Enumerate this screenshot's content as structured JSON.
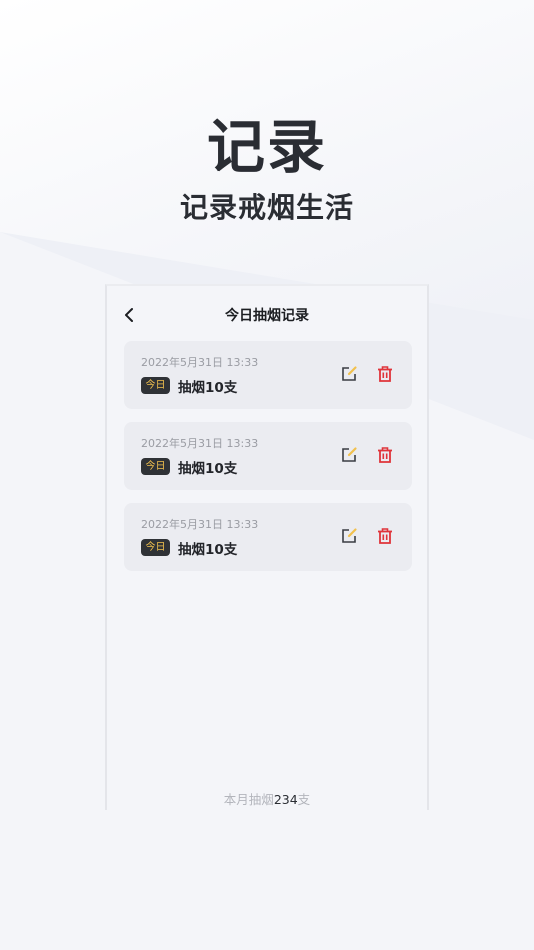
{
  "hero": {
    "title": "记录",
    "subtitle": "记录戒烟生活"
  },
  "screen": {
    "nav_title": "今日抽烟记录",
    "records": [
      {
        "time": "2022年5月31日 13:33",
        "badge": "今日",
        "text": "抽烟10支"
      },
      {
        "time": "2022年5月31日 13:33",
        "badge": "今日",
        "text": "抽烟10支"
      },
      {
        "time": "2022年5月31日 13:33",
        "badge": "今日",
        "text": "抽烟10支"
      }
    ],
    "footer": {
      "prefix": "本月抽烟",
      "count": "234",
      "suffix": "支"
    }
  },
  "icons": {
    "back": "chevron-left-icon",
    "edit": "edit-icon",
    "delete": "trash-icon"
  },
  "colors": {
    "badge_bg": "#2f3236",
    "badge_text": "#f2c14e",
    "delete": "#e0343a",
    "edit_accent": "#f2c14e"
  }
}
